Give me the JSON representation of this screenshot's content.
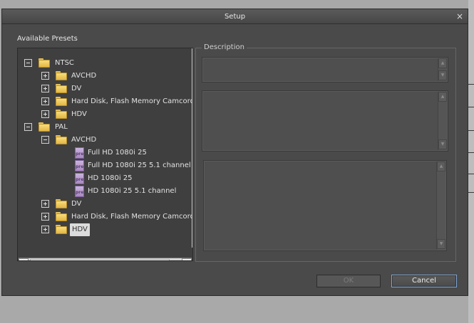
{
  "dialog": {
    "title": "Setup",
    "close_glyph": "×",
    "presets_label": "Available Presets",
    "description_label": "Description",
    "ok_label": "OK",
    "cancel_label": "Cancel"
  },
  "tree": {
    "ntsc": {
      "label": "NTSC",
      "expanded": true
    },
    "ntsc_children": [
      {
        "label": "AVCHD",
        "expanded": false
      },
      {
        "label": "DV",
        "expanded": false
      },
      {
        "label": "Hard Disk, Flash Memory Camcorde",
        "expanded": false
      },
      {
        "label": "HDV",
        "expanded": false
      }
    ],
    "pal": {
      "label": "PAL",
      "expanded": true
    },
    "pal_avchd": {
      "label": "AVCHD",
      "expanded": true
    },
    "pal_avchd_presets": [
      {
        "label": "Full HD 1080i 25",
        "icon_text": "prel"
      },
      {
        "label": "Full HD 1080i 25 5.1 channel",
        "icon_text": "prel"
      },
      {
        "label": "HD 1080i 25",
        "icon_text": "prel"
      },
      {
        "label": "HD 1080i 25 5.1 channel",
        "icon_text": "prel"
      }
    ],
    "pal_children": [
      {
        "label": "DV",
        "expanded": false
      },
      {
        "label": "Hard Disk, Flash Memory Camcorde",
        "expanded": false
      },
      {
        "label": "HDV",
        "expanded": false,
        "selected": true
      }
    ]
  },
  "scroll": {
    "left_arrow": "◀",
    "right_arrow": "▶",
    "up_arrow": "▲",
    "down_arrow": "▼"
  },
  "colors": {
    "dialog_bg": "#4a4a4a",
    "folder": "#f2d06b",
    "preset_icon": "#b89ace",
    "focus_border": "#7fa6d6"
  }
}
